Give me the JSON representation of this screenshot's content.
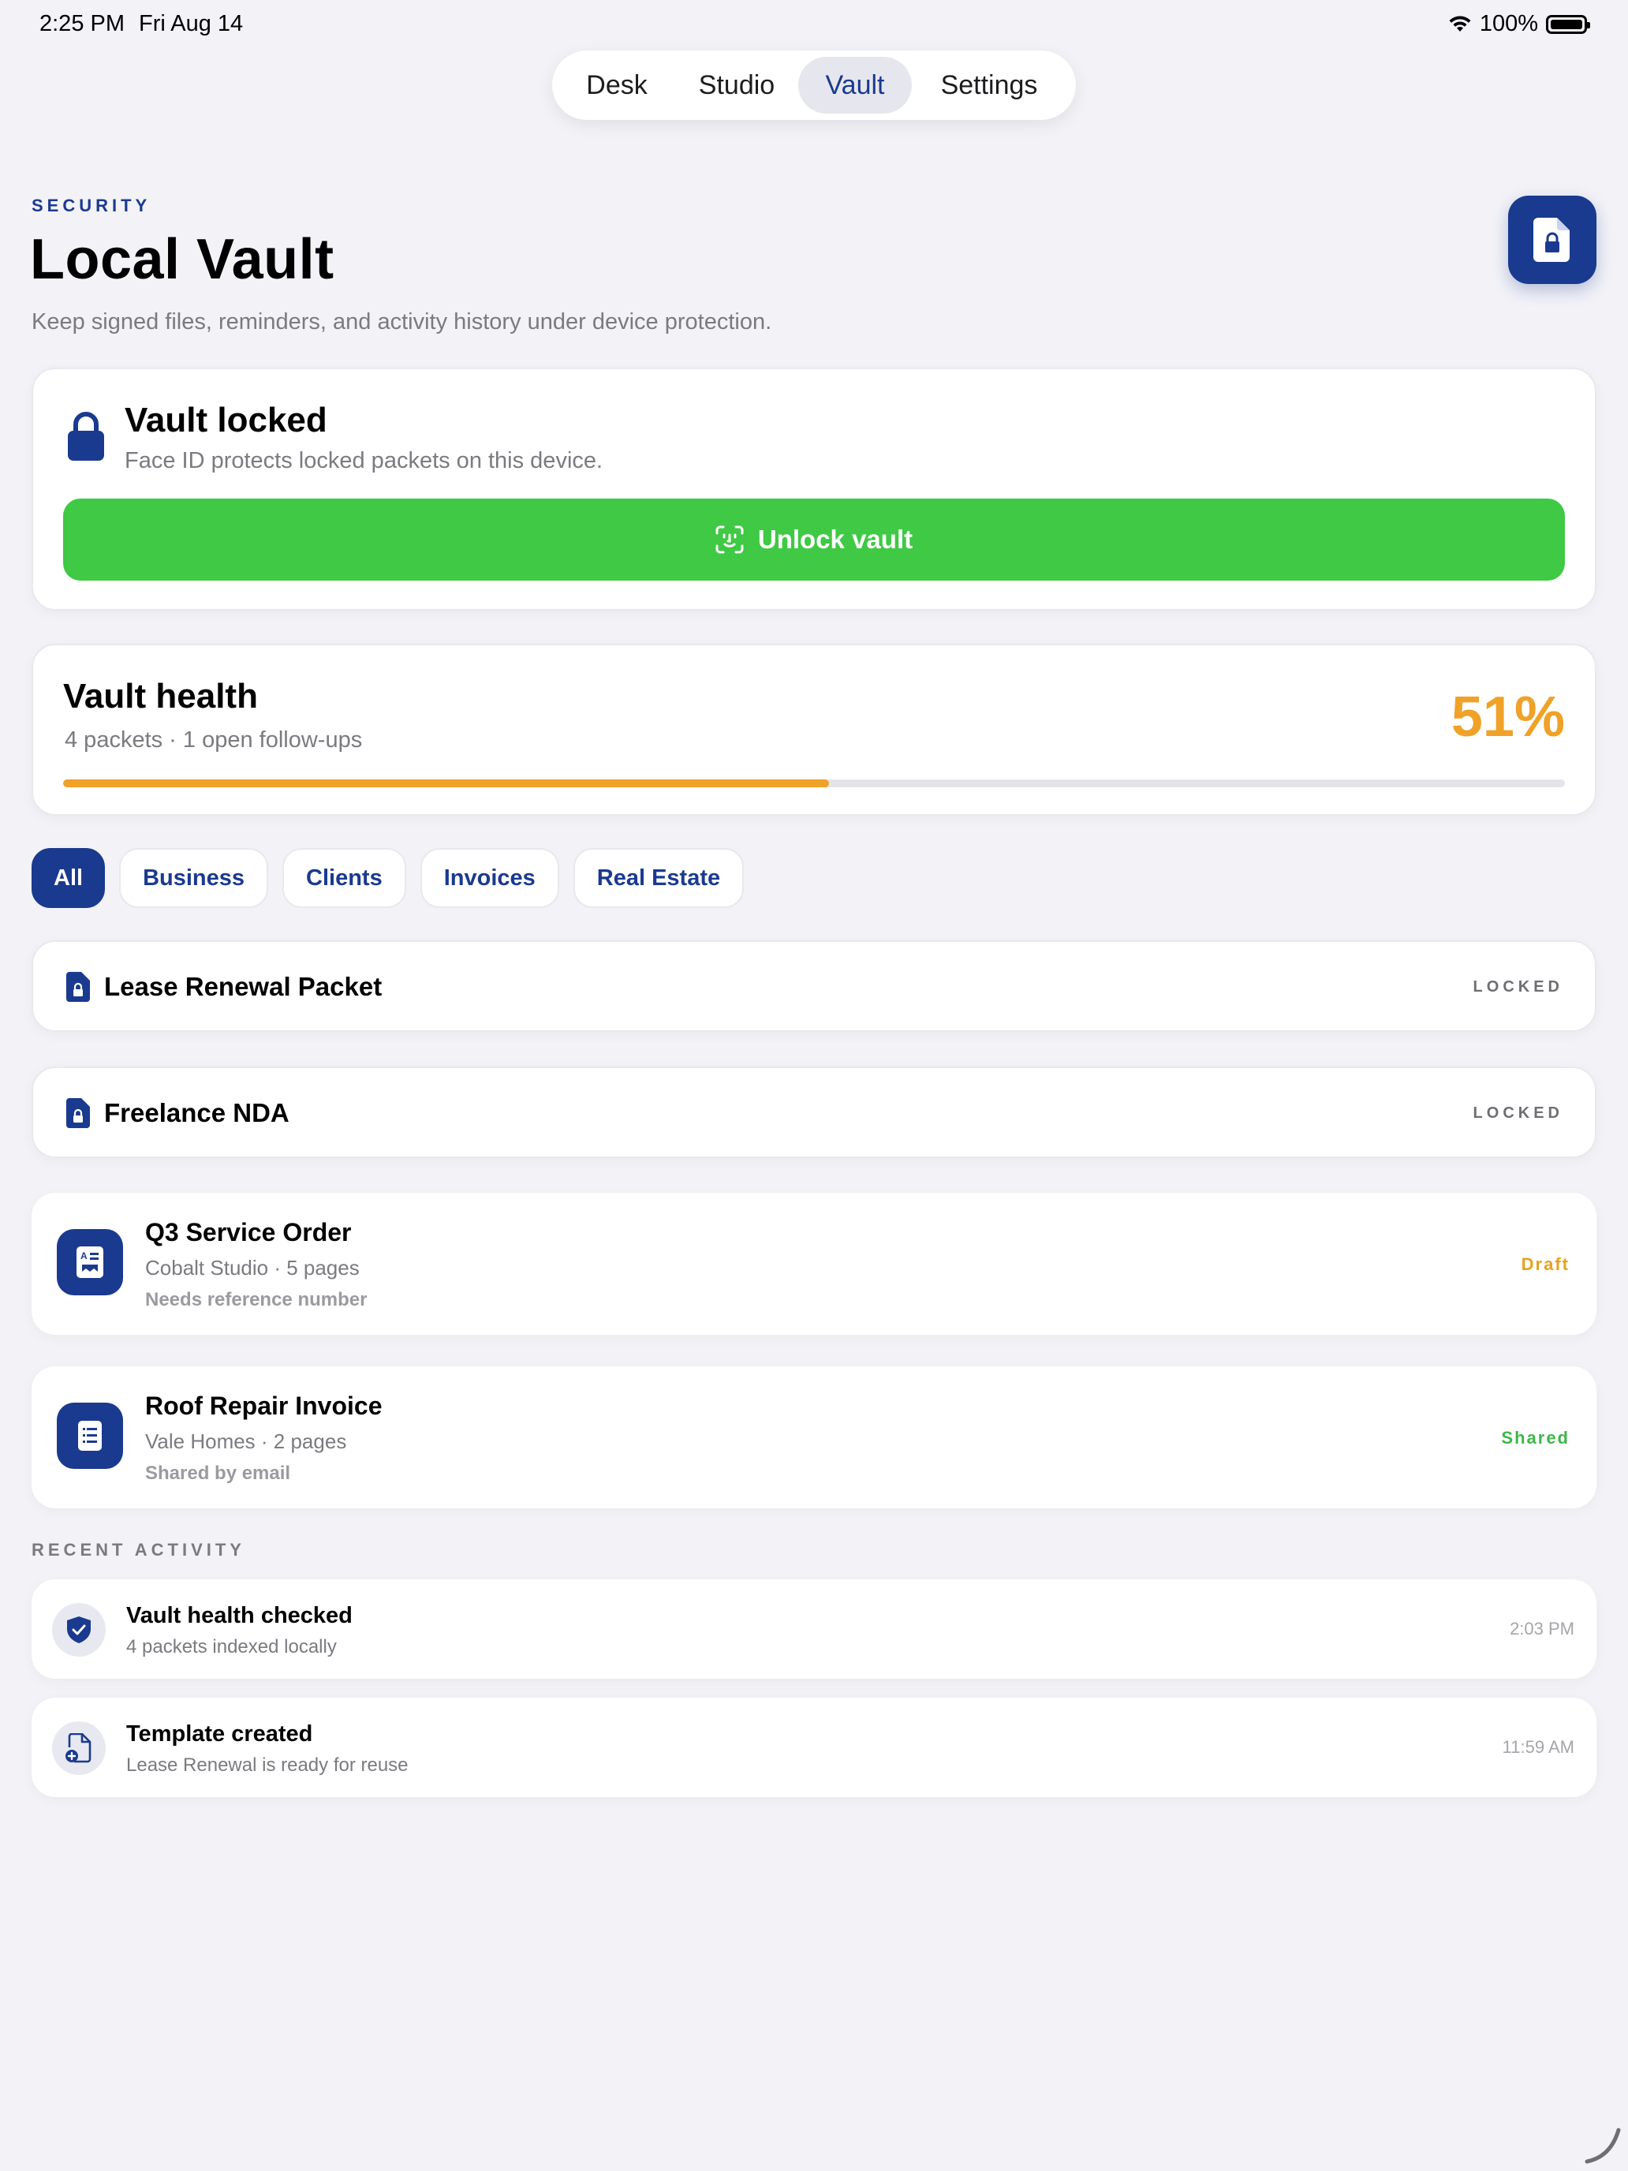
{
  "status_bar": {
    "time": "2:25 PM",
    "date": "Fri Aug 14",
    "battery": "100%"
  },
  "tabs": [
    {
      "label": "Desk",
      "active": false
    },
    {
      "label": "Studio",
      "active": false
    },
    {
      "label": "Vault",
      "active": true
    },
    {
      "label": "Settings",
      "active": false
    }
  ],
  "header": {
    "eyebrow": "SECURITY",
    "title": "Local Vault",
    "subtitle": "Keep signed files, reminders, and activity history under device protection.",
    "action_icon": "locked-document-icon"
  },
  "lock_card": {
    "title": "Vault locked",
    "subtitle": "Face ID protects locked packets on this device.",
    "button_label": "Unlock vault",
    "button_icon": "face-id-icon",
    "button_color": "#3FC944"
  },
  "health": {
    "title": "Vault health",
    "subtitle": "4 packets · 1 open follow-ups",
    "percent_label": "51%",
    "progress": 0.51,
    "accent": "#F0A127"
  },
  "filters": [
    {
      "label": "All",
      "active": true
    },
    {
      "label": "Business",
      "active": false
    },
    {
      "label": "Clients",
      "active": false
    },
    {
      "label": "Invoices",
      "active": false
    },
    {
      "label": "Real Estate",
      "active": false
    }
  ],
  "locked_packets": [
    {
      "title": "Lease Renewal Packet",
      "badge": "LOCKED"
    },
    {
      "title": "Freelance NDA",
      "badge": "LOCKED"
    }
  ],
  "documents": [
    {
      "title": "Q3 Service Order",
      "meta": "Cobalt Studio · 5 pages",
      "note": "Needs reference number",
      "status": "Draft",
      "status_color": "#E6A21E",
      "icon": "form-document-icon"
    },
    {
      "title": "Roof Repair Invoice",
      "meta": "Vale Homes · 2 pages",
      "note": "Shared by email",
      "status": "Shared",
      "status_color": "#3DB848",
      "icon": "invoice-icon"
    }
  ],
  "activity_label": "RECENT ACTIVITY",
  "activity": [
    {
      "title": "Vault health checked",
      "subtitle": "4 packets indexed locally",
      "time": "2:03 PM",
      "icon": "shield-check-icon"
    },
    {
      "title": "Template created",
      "subtitle": "Lease Renewal is ready for reuse",
      "time": "11:59 AM",
      "icon": "document-add-icon"
    }
  ],
  "colors": {
    "brand": "#1A3A8F",
    "background": "#F2F2F7"
  }
}
